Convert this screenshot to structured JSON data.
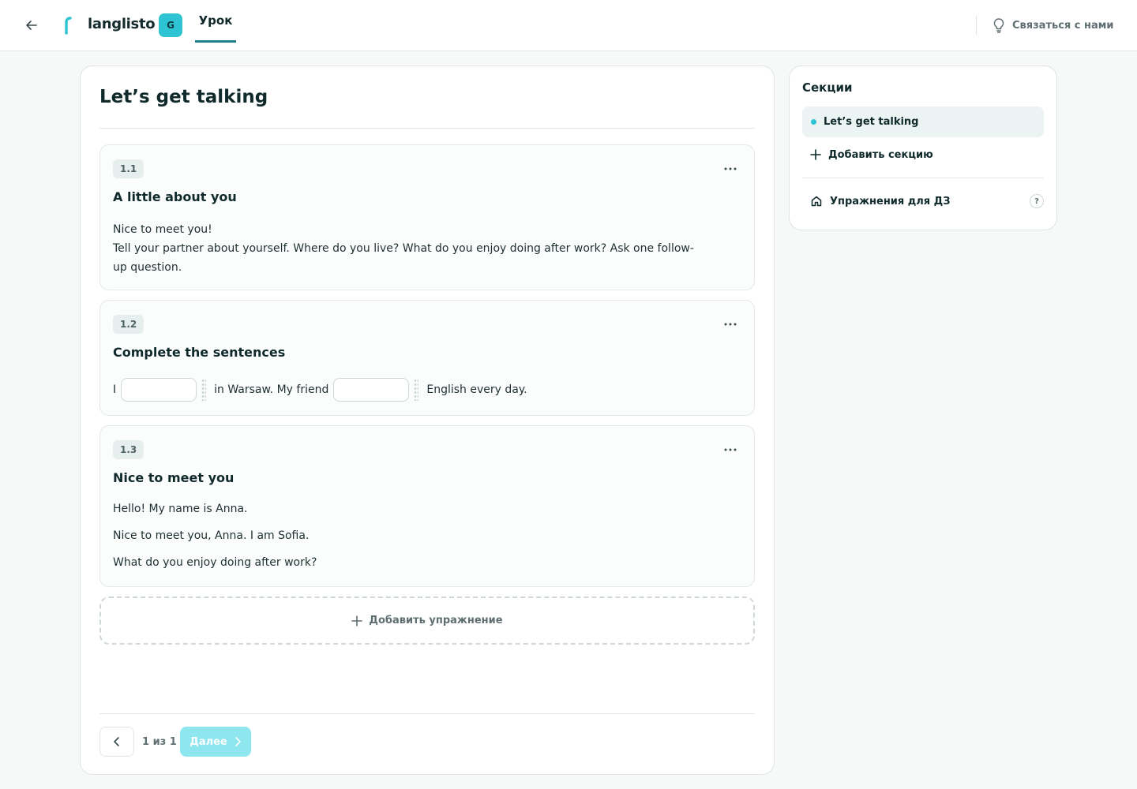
{
  "header": {
    "brand": "langlisto",
    "workspace_badge": "G",
    "tab_lesson": "Урок",
    "contact_label": "Связаться с нами"
  },
  "lesson": {
    "title": "Let’s get talking"
  },
  "exercises": [
    {
      "number": "1.1",
      "title": "A little about you",
      "lines": [
        "Nice to meet you!",
        "Tell your partner about yourself. Where do you live? What do you enjoy doing after work? Ask one follow-up question."
      ]
    },
    {
      "number": "1.2",
      "title": "Complete the sentences",
      "parts": [
        "I",
        "in Warsaw. My friend",
        "English every day."
      ],
      "gaps": [
        "",
        ""
      ]
    },
    {
      "number": "1.3",
      "title": "Nice to meet you",
      "lines": [
        "Hello! My name is Anna.",
        "Nice to meet you, Anna. I am Sofia.",
        "What do you enjoy doing after work?"
      ]
    }
  ],
  "add_exercise_label": "Добавить упражнение",
  "pagination": {
    "page_label": "1 из 1",
    "next_label": "Далее"
  },
  "sidebar": {
    "title": "Секции",
    "active_section": "Let’s get talking",
    "add_section_label": "Добавить секцию",
    "homework_label": "Упражнения для ДЗ",
    "help_glyph": "?"
  },
  "colors": {
    "accent": "#2ec4d4",
    "tab_underline": "#1f7f8a",
    "next_button": "#8ee6ee"
  },
  "icons": [
    "arrow-left-icon",
    "logo-icon",
    "lightbulb-icon",
    "more-horizontal-icon",
    "plus-icon",
    "chevron-left-icon",
    "chevron-right-icon",
    "home-icon",
    "help-icon"
  ]
}
